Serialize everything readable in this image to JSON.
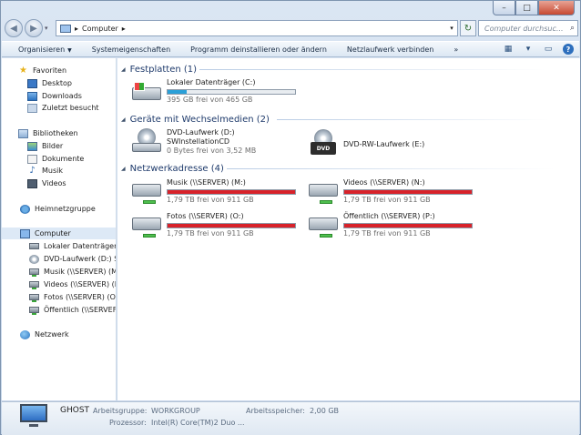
{
  "window": {
    "caption_minimize": "–",
    "caption_maximize": "□",
    "caption_close": "✕"
  },
  "address": {
    "back_icon": "back-arrow",
    "forward_icon": "forward-arrow",
    "path_root_sep": "▸",
    "path_item": "Computer",
    "path_sep": "▸",
    "search_placeholder": "Computer durchsuc..."
  },
  "command_bar": {
    "organize": "Organisieren",
    "properties": "Systemeigenschaften",
    "uninstall": "Programm deinstallieren oder ändern",
    "map_drive": "Netzlaufwerk verbinden",
    "more": "»"
  },
  "nav_pane": {
    "favorites": "Favoriten",
    "desktop": "Desktop",
    "downloads": "Downloads",
    "recent": "Zuletzt besucht",
    "libraries": "Bibliotheken",
    "pictures": "Bilder",
    "documents": "Dokumente",
    "music": "Musik",
    "videos": "Videos",
    "homegroup": "Heimnetzgruppe",
    "computer": "Computer",
    "local_disk": "Lokaler Datenträger",
    "dvd_drive": "DVD-Laufwerk (D:) S",
    "net_music": "Musik (\\\\SERVER) (M",
    "net_videos": "Videos (\\\\SERVER) (N",
    "net_fotos": "Fotos (\\\\SERVER) (O",
    "net_public": "Öffentlich (\\\\SERVEF",
    "network": "Netzwerk"
  },
  "groups": {
    "hard_disks": "Festplatten (1)",
    "removable": "Geräte mit Wechselmedien (2)",
    "network_locations": "Netzwerkadresse (4)"
  },
  "drives": {
    "c": {
      "name": "Lokaler Datenträger (C:)",
      "free": "395 GB frei von 465 GB",
      "used_fraction": 0.15,
      "bar_color": "#2aa0d8"
    },
    "d": {
      "name": "DVD-Laufwerk (D:)",
      "label": "SWInstellationCD",
      "free": "0 Bytes frei von 3,52 MB"
    },
    "e": {
      "name": "DVD-RW-Laufwerk (E:)",
      "badge": "DVD"
    },
    "m": {
      "name": "Musik (\\\\SERVER) (M:)",
      "free": "1,79 TB frei von 911 GB",
      "used_fraction": 1.0,
      "bar_color": "#d8222a"
    },
    "n": {
      "name": "Videos (\\\\SERVER) (N:)",
      "free": "1,79 TB frei von 911 GB",
      "used_fraction": 1.0,
      "bar_color": "#d8222a"
    },
    "o": {
      "name": "Fotos (\\\\SERVER) (O:)",
      "free": "1,79 TB frei von 911 GB",
      "used_fraction": 1.0,
      "bar_color": "#d8222a"
    },
    "p": {
      "name": "Öffentlich (\\\\SERVER) (P:)",
      "free": "1,79 TB frei von 911 GB",
      "used_fraction": 1.0,
      "bar_color": "#d8222a"
    }
  },
  "details": {
    "pc_name": "GHOST",
    "workgroup_label": "Arbeitsgruppe:",
    "workgroup": "WORKGROUP",
    "memory_label": "Arbeitsspeicher:",
    "memory": "2,00 GB",
    "processor_label": "Prozessor:",
    "processor": "Intel(R) Core(TM)2 Duo ..."
  }
}
